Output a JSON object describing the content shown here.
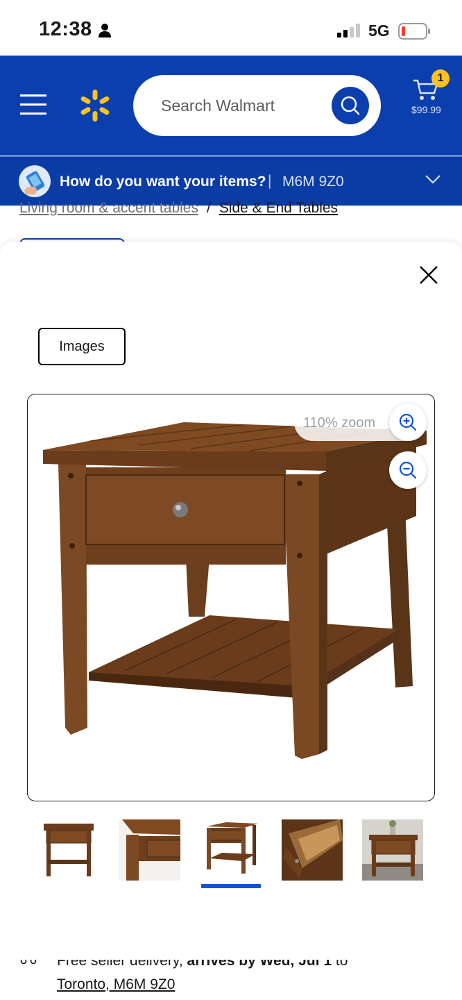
{
  "status_bar": {
    "time": "12:38",
    "network": "5G"
  },
  "header": {
    "search_placeholder": "Search Walmart",
    "cart_count": "1",
    "cart_total": "$99.99",
    "brand_color": "#0B3FAE",
    "accent_color": "#FFC220"
  },
  "delivery": {
    "question": "How do you want your items?",
    "separator": "|",
    "postal_code": "M6M 9Z0"
  },
  "breadcrumb": {
    "items": [
      "Living room & accent tables",
      "Side & End Tables"
    ],
    "separator": "/"
  },
  "modal": {
    "tab_label": "Images",
    "zoom_level": "110% zoom",
    "thumbnails": [
      {
        "name": "end-table-front"
      },
      {
        "name": "end-table-closeup"
      },
      {
        "name": "end-table-angle"
      },
      {
        "name": "end-table-drawer-open"
      },
      {
        "name": "end-table-room-setting"
      }
    ],
    "selected_thumbnail": 3
  },
  "shipping": {
    "prefix": "Free seller delivery, ",
    "bold": "arrives by Wed, Jul 1",
    "suffix": " to",
    "location": "Toronto, M6M 9Z0"
  }
}
